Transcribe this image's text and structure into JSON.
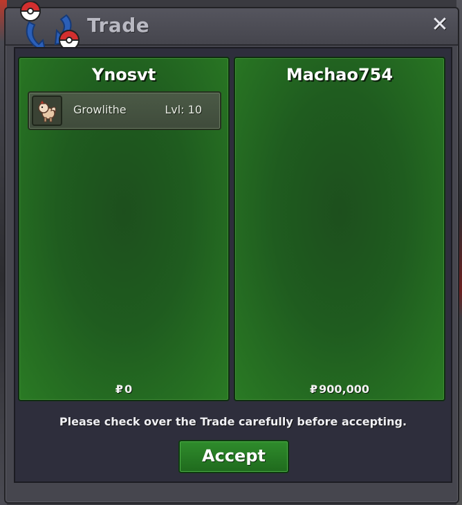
{
  "window": {
    "title": "Trade",
    "close_symbol": "✕",
    "logo_icon": "trade-pokeball-arrows-icon"
  },
  "trade": {
    "left": {
      "player_name": "Ynosvt",
      "currency_symbol": "₽",
      "money": "0",
      "items": [
        {
          "icon": "growlithe-sprite-icon",
          "name": "Growlithe",
          "level_text": "Lvl: 10"
        }
      ]
    },
    "right": {
      "player_name": "Machao754",
      "currency_symbol": "₽",
      "money": "900,000",
      "items": []
    }
  },
  "footer": {
    "notice": "Please check over the Trade carefully before accepting.",
    "accept_label": "Accept"
  },
  "colors": {
    "panel_green": "#1f5c1f",
    "accept_green": "#2f8c2c",
    "window_gray": "#46464e",
    "content_dark": "#2e2e3c"
  }
}
